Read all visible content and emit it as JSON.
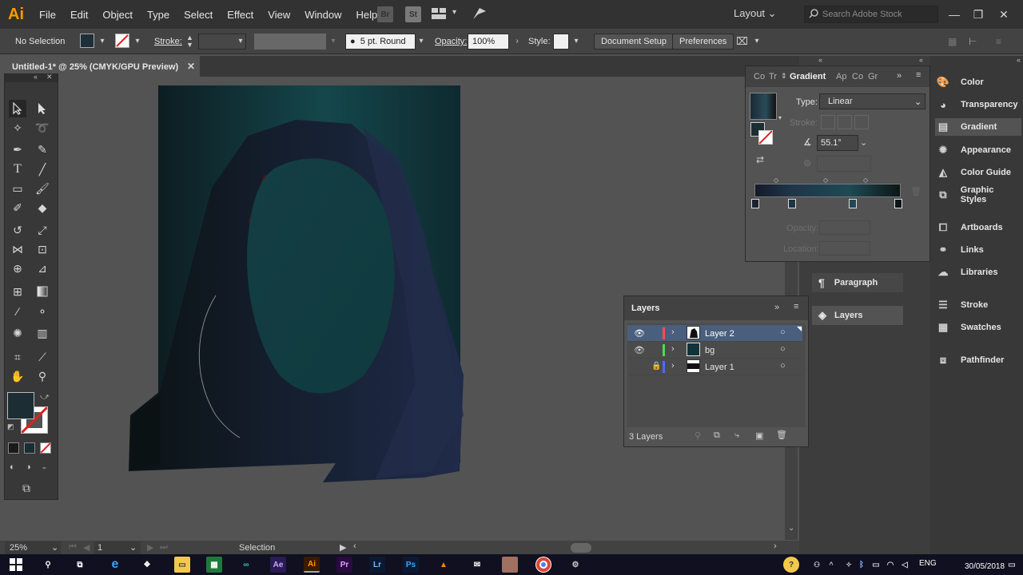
{
  "app": {
    "logo": "Ai",
    "menu": [
      "File",
      "Edit",
      "Object",
      "Type",
      "Select",
      "Effect",
      "View",
      "Window",
      "Help"
    ],
    "bridge_btn": "Br",
    "stock_btn": "St",
    "workspace": "Layout",
    "search_placeholder": "Search Adobe Stock"
  },
  "control_bar": {
    "selection_label": "No Selection",
    "stroke_label": "Stroke:",
    "brush": "5 pt. Round",
    "opacity_label": "Opacity:",
    "opacity_value": "100%",
    "style_label": "Style:",
    "document_setup": "Document Setup",
    "preferences": "Preferences"
  },
  "document": {
    "tab_title": "Untitled-1* @ 25% (CMYK/GPU Preview)"
  },
  "gradient_panel": {
    "tabs": [
      "Co",
      "Tr",
      "Gradient",
      "Ap",
      "Co",
      "Gr"
    ],
    "type_label": "Type:",
    "type_value": "Linear",
    "stroke_label": "Stroke:",
    "angle_value": "55.1°",
    "opacity_label": "Opacity:",
    "location_label": "Location:"
  },
  "layers_panel": {
    "title": "Layers",
    "layers": [
      {
        "name": "Layer 2",
        "color": "#ff4d4d",
        "visible": true,
        "locked": false,
        "selected": true
      },
      {
        "name": "bg",
        "color": "#4ddd4d",
        "visible": true,
        "locked": false,
        "selected": false
      },
      {
        "name": "Layer 1",
        "color": "#4d6bff",
        "visible": false,
        "locked": true,
        "selected": false
      }
    ],
    "count": "3 Layers"
  },
  "mid_dock": {
    "items": [
      "Paragraph",
      "Layers"
    ]
  },
  "right_dock": {
    "items": [
      "Color",
      "Transparency",
      "Gradient",
      "Appearance",
      "Color Guide",
      "Graphic Styles",
      "Artboards",
      "Links",
      "Libraries",
      "Stroke",
      "Swatches",
      "Pathfinder"
    ]
  },
  "status_bar": {
    "zoom": "25%",
    "artboard": "1",
    "tool": "Selection"
  },
  "taskbar": {
    "lang": "ENG",
    "date": "30/05/2018"
  },
  "colors": {
    "accent_orange": "#ff9a00",
    "selected_row": "#4a5f7d",
    "artwork_dark": "#0e1a1c",
    "artwork_teal": "#14464a"
  }
}
